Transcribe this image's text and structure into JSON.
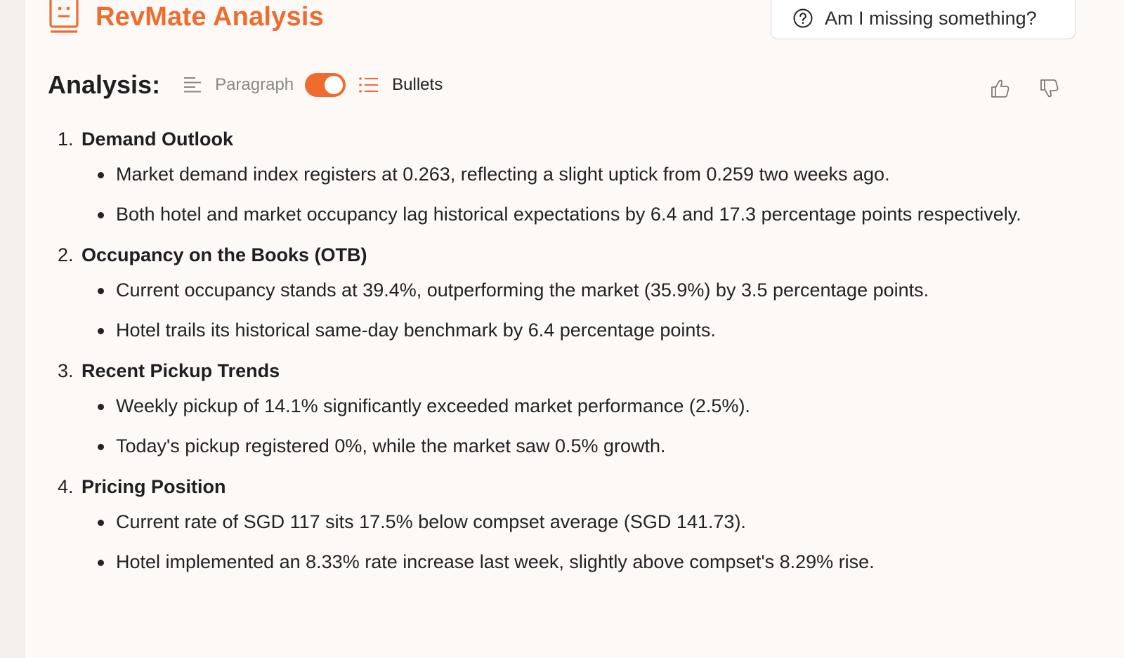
{
  "header": {
    "title": "RevMate Analysis",
    "brand_icon": "robot-face-icon",
    "help_button_label": "Am I missing something?",
    "help_icon": "question-circle-icon"
  },
  "analysis": {
    "heading": "Analysis:",
    "paragraph_label": "Paragraph",
    "bullets_label": "Bullets",
    "mode": "bullets",
    "accent_color": "#ef6c2f"
  },
  "sections": [
    {
      "number": "1.",
      "title": "Demand Outlook",
      "bullets": [
        "Market demand index registers at 0.263, reflecting a slight uptick from 0.259 two weeks ago.",
        "Both hotel and market occupancy lag historical expectations by 6.4 and 17.3 percentage points respectively."
      ]
    },
    {
      "number": "2.",
      "title": "Occupancy on the Books (OTB)",
      "bullets": [
        "Current occupancy stands at 39.4%, outperforming the market (35.9%) by 3.5 percentage points.",
        "Hotel trails its historical same-day benchmark by 6.4 percentage points."
      ]
    },
    {
      "number": "3.",
      "title": "Recent Pickup Trends",
      "bullets": [
        "Weekly pickup of 14.1% significantly exceeded market performance (2.5%).",
        "Today's pickup registered 0%, while the market saw 0.5% growth."
      ]
    },
    {
      "number": "4.",
      "title": "Pricing Position",
      "bullets": [
        "Current rate of SGD 117 sits 17.5% below compset average (SGD 141.73).",
        "Hotel implemented an 8.33% rate increase last week, slightly above compset's 8.29% rise."
      ]
    }
  ]
}
